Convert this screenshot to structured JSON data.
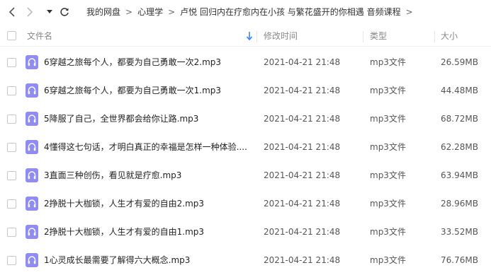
{
  "breadcrumb": {
    "items": [
      "我的网盘",
      "心理学",
      "卢悦 回归内在疗愈内在小孩 与繁花盛开的你相遇 音频课程"
    ],
    "separator": ">"
  },
  "table": {
    "headers": {
      "name": "文件名",
      "modified": "修改时间",
      "type": "类型",
      "size": "大小"
    },
    "sort": {
      "column": "name",
      "direction": "descending"
    },
    "rows": [
      {
        "name": "6穿越之旅每个人，都要为自己勇敢一次2.mp3",
        "modified": "2021-04-21 21:48",
        "type": "mp3文件",
        "size": "26.59MB",
        "icon": "audio-file-icon"
      },
      {
        "name": "6穿越之旅每个人，都要为自己勇敢一次1.mp3",
        "modified": "2021-04-21 21:48",
        "type": "mp3文件",
        "size": "44.48MB",
        "icon": "audio-file-icon"
      },
      {
        "name": "5降服了自己，全世界都会给你让路.mp3",
        "modified": "2021-04-21 21:48",
        "type": "mp3文件",
        "size": "68.72MB",
        "icon": "audio-file-icon"
      },
      {
        "name": "4懂得这七句话，才明白真正的幸福是怎样一种体验....",
        "modified": "2021-04-21 21:48",
        "type": "mp3文件",
        "size": "62.28MB",
        "icon": "audio-file-icon"
      },
      {
        "name": "3直面三种创伤，看见就是疗愈.mp3",
        "modified": "2021-04-21 21:48",
        "type": "mp3文件",
        "size": "63.94MB",
        "icon": "audio-file-icon"
      },
      {
        "name": "2挣脱十大枷锁，人生才有爱的自由2.mp3",
        "modified": "2021-04-21 21:48",
        "type": "mp3文件",
        "size": "28.96MB",
        "icon": "audio-file-icon"
      },
      {
        "name": "2挣脱十大枷锁，人生才有爱的自由1.mp3",
        "modified": "2021-04-21 21:48",
        "type": "mp3文件",
        "size": "33.52MB",
        "icon": "audio-file-icon"
      },
      {
        "name": "1心灵成长最需要了解得六大概念.mp3",
        "modified": "2021-04-21 21:48",
        "type": "mp3文件",
        "size": "76.76MB",
        "icon": "audio-file-icon"
      }
    ]
  },
  "colors": {
    "icon_fill": "#8f8df2",
    "sort_arrow": "#3b82f6",
    "text": "#222222",
    "muted": "#888888"
  }
}
